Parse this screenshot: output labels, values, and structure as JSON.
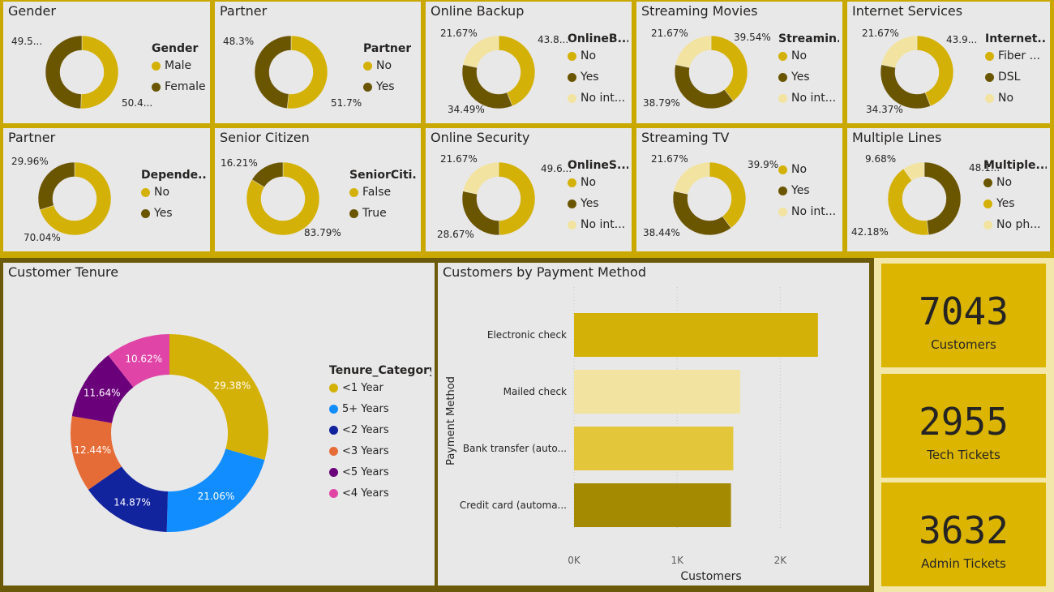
{
  "colors": {
    "gold": "#d4b106",
    "dark": "#6b5600",
    "light": "#f2e3a0",
    "tenure": [
      "#d4b106",
      "#118dff",
      "#12239e",
      "#e66c37",
      "#6b007b",
      "#e044a7"
    ],
    "bar": [
      "#d4b106",
      "#f2e3a0",
      "#e3c63a",
      "#a48a00"
    ]
  },
  "kpis": [
    {
      "value": "7043",
      "label": "Customers"
    },
    {
      "value": "2955",
      "label": "Tech Tickets"
    },
    {
      "value": "3632",
      "label": "Admin Tickets"
    }
  ],
  "chart_data": [
    {
      "type": "pie",
      "title": "Gender",
      "legend_title": "Gender",
      "labels": [
        "Male",
        "Female"
      ],
      "values": [
        50.4,
        49.5
      ],
      "data_labels": [
        "50.4...",
        "49.5..."
      ],
      "colors": [
        "#d4b106",
        "#6b5600"
      ]
    },
    {
      "type": "pie",
      "title": "Partner",
      "legend_title": "Partner",
      "labels": [
        "No",
        "Yes"
      ],
      "values": [
        51.7,
        48.3
      ],
      "data_labels": [
        "51.7%",
        "48.3%"
      ],
      "colors": [
        "#d4b106",
        "#6b5600"
      ]
    },
    {
      "type": "pie",
      "title": "Online Backup",
      "legend_title": "OnlineB...",
      "labels": [
        "No",
        "Yes",
        "No int..."
      ],
      "values": [
        43.84,
        34.49,
        21.67
      ],
      "data_labels": [
        "43.8...",
        "34.49%",
        "21.67%"
      ],
      "colors": [
        "#d4b106",
        "#6b5600",
        "#f2e3a0"
      ]
    },
    {
      "type": "pie",
      "title": "Streaming Movies",
      "legend_title": "Streamin...",
      "labels": [
        "No",
        "Yes",
        "No int..."
      ],
      "values": [
        39.54,
        38.79,
        21.67
      ],
      "data_labels": [
        "39.54%",
        "38.79%",
        "21.67%"
      ],
      "colors": [
        "#d4b106",
        "#6b5600",
        "#f2e3a0"
      ]
    },
    {
      "type": "pie",
      "title": "Internet Services",
      "legend_title": "Internet...",
      "labels": [
        "Fiber ...",
        "DSL",
        "No"
      ],
      "values": [
        43.96,
        34.37,
        21.67
      ],
      "data_labels": [
        "43.9...",
        "34.37%",
        "21.67%"
      ],
      "colors": [
        "#d4b106",
        "#6b5600",
        "#f2e3a0"
      ]
    },
    {
      "type": "pie",
      "title": "Partner",
      "legend_title": "Depende...",
      "labels": [
        "No",
        "Yes"
      ],
      "values": [
        70.04,
        29.96
      ],
      "data_labels": [
        "70.04%",
        "29.96%"
      ],
      "colors": [
        "#d4b106",
        "#6b5600"
      ]
    },
    {
      "type": "pie",
      "title": "Senior Citizen",
      "legend_title": "SeniorCiti...",
      "labels": [
        "False",
        "True"
      ],
      "values": [
        83.79,
        16.21
      ],
      "data_labels": [
        "83.79%",
        "16.21%"
      ],
      "colors": [
        "#d4b106",
        "#6b5600"
      ]
    },
    {
      "type": "pie",
      "title": "Online Security",
      "legend_title": "OnlineS...",
      "labels": [
        "No",
        "Yes",
        "No int..."
      ],
      "values": [
        49.66,
        28.67,
        21.67
      ],
      "data_labels": [
        "49.6...",
        "28.67%",
        "21.67%"
      ],
      "colors": [
        "#d4b106",
        "#6b5600",
        "#f2e3a0"
      ]
    },
    {
      "type": "pie",
      "title": "Streaming TV",
      "legend_title": "",
      "labels": [
        "No",
        "Yes",
        "No int..."
      ],
      "values": [
        39.9,
        38.44,
        21.67
      ],
      "data_labels": [
        "39.9%",
        "38.44%",
        "21.67%"
      ],
      "colors": [
        "#d4b106",
        "#6b5600",
        "#f2e3a0"
      ]
    },
    {
      "type": "pie",
      "title": "Multiple Lines",
      "legend_title": "Multiple...",
      "labels": [
        "No",
        "Yes",
        "No ph..."
      ],
      "values": [
        48.13,
        42.18,
        9.68
      ],
      "data_labels": [
        "48.1...",
        "42.18%",
        "9.68%"
      ],
      "colors": [
        "#6b5600",
        "#d4b106",
        "#f2e3a0"
      ]
    },
    {
      "type": "pie",
      "title": "Customer Tenure",
      "legend_title": "Tenure_Category",
      "labels": [
        "<1 Year",
        "5+ Years",
        "<2 Years",
        "<3 Years",
        "<5 Years",
        "<4 Years"
      ],
      "values": [
        29.38,
        21.06,
        14.87,
        12.44,
        11.64,
        10.62
      ],
      "data_labels": [
        "29.38%",
        "21.06%",
        "14.87%",
        "12.44%",
        "11.64%",
        "10.62%"
      ],
      "colors": [
        "#d4b106",
        "#118dff",
        "#12239e",
        "#e66c37",
        "#6b007b",
        "#e044a7"
      ]
    },
    {
      "type": "bar",
      "orientation": "horizontal",
      "title": "Customers by Payment Method",
      "categories": [
        "Electronic check",
        "Mailed check",
        "Bank transfer (auto...",
        "Credit card (automa..."
      ],
      "values": [
        2365,
        1612,
        1544,
        1522
      ],
      "xlabel": "Customers",
      "ylabel": "Payment Method",
      "xlim": [
        0,
        2500
      ],
      "ticks": [
        0,
        1000,
        2000
      ],
      "tick_labels": [
        "0K",
        "1K",
        "2K"
      ],
      "grid": true
    }
  ]
}
